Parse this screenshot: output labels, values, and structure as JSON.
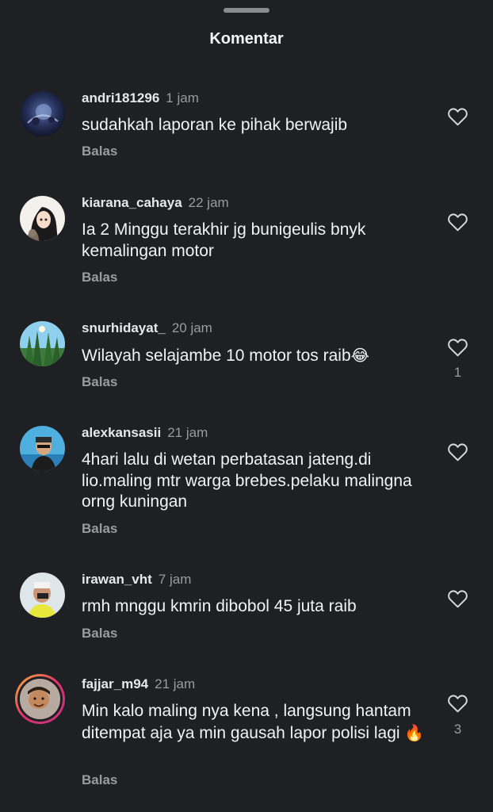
{
  "header": {
    "title": "Komentar"
  },
  "reply_label": "Balas",
  "comments": [
    {
      "username": "andri181296",
      "time": "1 jam",
      "text": "sudahkah laporan ke pihak berwajib",
      "likes": ""
    },
    {
      "username": "kiarana_cahaya",
      "time": "22 jam",
      "text": "Ia 2 Minggu terakhir jg bunigeulis bnyk kemalingan motor",
      "likes": ""
    },
    {
      "username": "snurhidayat_",
      "time": "20 jam",
      "text": "Wilayah selajambe 10 motor tos raib",
      "emoji": "😂",
      "likes": "1"
    },
    {
      "username": "alexkansasii",
      "time": "21 jam",
      "text": "4hari lalu di wetan perbatasan jateng.di lio.maling mtr warga brebes.pelaku malingna orng kuningan",
      "likes": ""
    },
    {
      "username": "irawan_vht",
      "time": "7 jam",
      "text": "rmh mnggu kmrin dibobol 45 juta raib",
      "likes": ""
    },
    {
      "username": "fajjar_m94",
      "time": "21 jam",
      "text": "Min kalo maling nya kena , langsung hantam ditempat aja ya min gausah lapor polisi lagi",
      "emoji": "🔥",
      "likes": "3"
    }
  ],
  "colors": {
    "background": "#1f2024",
    "text": "#f2f2f2",
    "muted": "#9a9ba0"
  },
  "icons": {
    "like": "heart-outline-icon",
    "sheet": "drag-handle"
  }
}
